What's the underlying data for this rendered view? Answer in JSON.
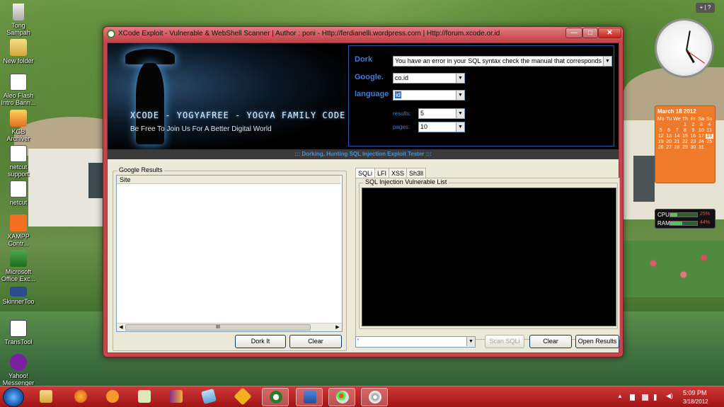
{
  "window": {
    "title": "XCode Exploit - Vulnerable & WebShell Scanner | Author : poni  - Http://ferdianelli.wordpress.com | Http://forum.xcode.or.id",
    "min_label": "—",
    "max_label": "□",
    "close_label": "✕"
  },
  "banner": {
    "title": "XCODE - YOGYAFREE - YOGYA FAMILY CODE",
    "subtitle": "Be Free To Join Us For A Better Digital World",
    "dork_label": "Dork",
    "dork_value": "You have an error in your SQL syntax check the manual that corresponds to your M",
    "google_label": "Google.",
    "google_value": "co.id",
    "language_label": "language",
    "language_value": "id",
    "results_label": "results:",
    "results_value": "5",
    "pages_label": "pages:",
    "pages_value": "10"
  },
  "strip_text": "::: Dorking, Hunting  SQL Injection Exploit Tester :::",
  "google_results": {
    "group_title": "Google Results",
    "column_site": "Site",
    "scroll_thumb": "III",
    "dork_button": "Dork It",
    "clear_button": "Clear"
  },
  "tabs": [
    "SQLi",
    "LFI",
    "XSS",
    "Sh3ll"
  ],
  "sqli": {
    "group_title": "SQL Injection Vulnerable List",
    "combo_value": "'",
    "scan_button": "Scan SQLi",
    "clear_button": "Clear",
    "open_button": "Open Results"
  },
  "desktop_icons": [
    {
      "label": "Tong Sampah",
      "icon": "recycle-bin-icon"
    },
    {
      "label": "New folder",
      "icon": "folder-icon"
    },
    {
      "label": "Aleo Flash Intro Bann...",
      "icon": "aleo-flash-icon"
    },
    {
      "label": "KGB Archiver",
      "icon": "kgb-archiver-icon"
    },
    {
      "label": "netcut support",
      "icon": "netcut-support-icon"
    },
    {
      "label": "netcut",
      "icon": "netcut-icon"
    },
    {
      "label": "XAMPP Contr...",
      "icon": "xampp-icon"
    },
    {
      "label": "Microsoft Office Exc...",
      "icon": "excel-icon"
    },
    {
      "label": "SkinnerToo",
      "icon": "skinner-tool-icon"
    },
    {
      "label": "TransTool",
      "icon": "transtool-icon"
    },
    {
      "label": "Yahoo! Messenger",
      "icon": "yahoo-messenger-icon"
    }
  ],
  "calendar": {
    "header": "March 18  2012",
    "days": [
      "Mo",
      "Tu",
      "We",
      "Th",
      "Fr",
      "Sa",
      "Su"
    ],
    "dates": [
      "",
      "",
      "",
      "1",
      "2",
      "3",
      "4",
      "5",
      "6",
      "7",
      "8",
      "9",
      "10",
      "11",
      "12",
      "13",
      "14",
      "15",
      "16",
      "17",
      "18",
      "19",
      "20",
      "21",
      "22",
      "23",
      "24",
      "25",
      "26",
      "27",
      "28",
      "29",
      "30",
      "31",
      ""
    ],
    "today": "18"
  },
  "meter": {
    "cpu_label": "CPU",
    "cpu_value": "25%",
    "cpu_level": 0.25,
    "ram_label": "RAM",
    "ram_value": "44%",
    "ram_level": 0.44
  },
  "gadget_controls": "+ | ?",
  "taskbar": {
    "time": "5:09 PM",
    "date": "3/18/2012",
    "icons": [
      "explorer-icon",
      "firefox-icon",
      "scratch-icon",
      "notepad-icon",
      "winrar-icon",
      "photoshop-icon",
      "winamp-icon",
      "xcode-exploit-icon",
      "word-icon",
      "paint-icon",
      "disc-burner-icon"
    ]
  },
  "colors": {
    "window_frame": "#c9444a",
    "taskbar": "#b81d1d",
    "banner_label": "#3f7ed8",
    "calendar": "#ef7b2a"
  }
}
